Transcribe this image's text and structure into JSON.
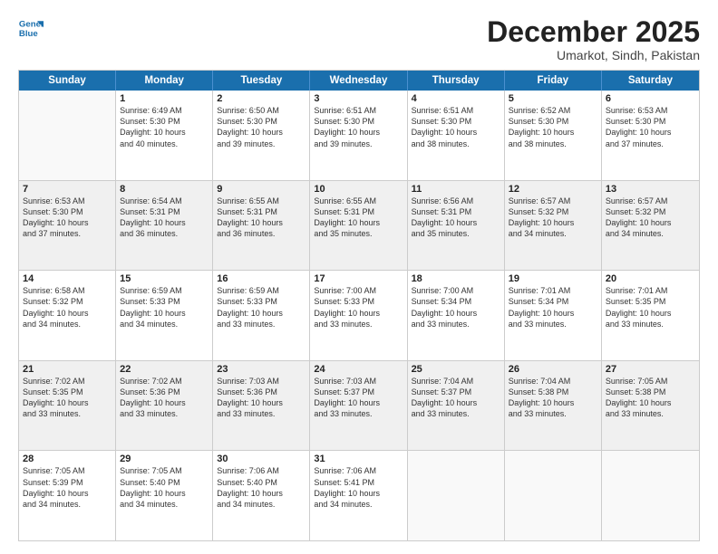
{
  "logo": {
    "line1": "General",
    "line2": "Blue"
  },
  "title": "December 2025",
  "subtitle": "Umarkot, Sindh, Pakistan",
  "header_days": [
    "Sunday",
    "Monday",
    "Tuesday",
    "Wednesday",
    "Thursday",
    "Friday",
    "Saturday"
  ],
  "rows": [
    [
      {
        "day": "",
        "detail": ""
      },
      {
        "day": "1",
        "detail": "Sunrise: 6:49 AM\nSunset: 5:30 PM\nDaylight: 10 hours\nand 40 minutes."
      },
      {
        "day": "2",
        "detail": "Sunrise: 6:50 AM\nSunset: 5:30 PM\nDaylight: 10 hours\nand 39 minutes."
      },
      {
        "day": "3",
        "detail": "Sunrise: 6:51 AM\nSunset: 5:30 PM\nDaylight: 10 hours\nand 39 minutes."
      },
      {
        "day": "4",
        "detail": "Sunrise: 6:51 AM\nSunset: 5:30 PM\nDaylight: 10 hours\nand 38 minutes."
      },
      {
        "day": "5",
        "detail": "Sunrise: 6:52 AM\nSunset: 5:30 PM\nDaylight: 10 hours\nand 38 minutes."
      },
      {
        "day": "6",
        "detail": "Sunrise: 6:53 AM\nSunset: 5:30 PM\nDaylight: 10 hours\nand 37 minutes."
      }
    ],
    [
      {
        "day": "7",
        "detail": "Sunrise: 6:53 AM\nSunset: 5:30 PM\nDaylight: 10 hours\nand 37 minutes."
      },
      {
        "day": "8",
        "detail": "Sunrise: 6:54 AM\nSunset: 5:31 PM\nDaylight: 10 hours\nand 36 minutes."
      },
      {
        "day": "9",
        "detail": "Sunrise: 6:55 AM\nSunset: 5:31 PM\nDaylight: 10 hours\nand 36 minutes."
      },
      {
        "day": "10",
        "detail": "Sunrise: 6:55 AM\nSunset: 5:31 PM\nDaylight: 10 hours\nand 35 minutes."
      },
      {
        "day": "11",
        "detail": "Sunrise: 6:56 AM\nSunset: 5:31 PM\nDaylight: 10 hours\nand 35 minutes."
      },
      {
        "day": "12",
        "detail": "Sunrise: 6:57 AM\nSunset: 5:32 PM\nDaylight: 10 hours\nand 34 minutes."
      },
      {
        "day": "13",
        "detail": "Sunrise: 6:57 AM\nSunset: 5:32 PM\nDaylight: 10 hours\nand 34 minutes."
      }
    ],
    [
      {
        "day": "14",
        "detail": "Sunrise: 6:58 AM\nSunset: 5:32 PM\nDaylight: 10 hours\nand 34 minutes."
      },
      {
        "day": "15",
        "detail": "Sunrise: 6:59 AM\nSunset: 5:33 PM\nDaylight: 10 hours\nand 34 minutes."
      },
      {
        "day": "16",
        "detail": "Sunrise: 6:59 AM\nSunset: 5:33 PM\nDaylight: 10 hours\nand 33 minutes."
      },
      {
        "day": "17",
        "detail": "Sunrise: 7:00 AM\nSunset: 5:33 PM\nDaylight: 10 hours\nand 33 minutes."
      },
      {
        "day": "18",
        "detail": "Sunrise: 7:00 AM\nSunset: 5:34 PM\nDaylight: 10 hours\nand 33 minutes."
      },
      {
        "day": "19",
        "detail": "Sunrise: 7:01 AM\nSunset: 5:34 PM\nDaylight: 10 hours\nand 33 minutes."
      },
      {
        "day": "20",
        "detail": "Sunrise: 7:01 AM\nSunset: 5:35 PM\nDaylight: 10 hours\nand 33 minutes."
      }
    ],
    [
      {
        "day": "21",
        "detail": "Sunrise: 7:02 AM\nSunset: 5:35 PM\nDaylight: 10 hours\nand 33 minutes."
      },
      {
        "day": "22",
        "detail": "Sunrise: 7:02 AM\nSunset: 5:36 PM\nDaylight: 10 hours\nand 33 minutes."
      },
      {
        "day": "23",
        "detail": "Sunrise: 7:03 AM\nSunset: 5:36 PM\nDaylight: 10 hours\nand 33 minutes."
      },
      {
        "day": "24",
        "detail": "Sunrise: 7:03 AM\nSunset: 5:37 PM\nDaylight: 10 hours\nand 33 minutes."
      },
      {
        "day": "25",
        "detail": "Sunrise: 7:04 AM\nSunset: 5:37 PM\nDaylight: 10 hours\nand 33 minutes."
      },
      {
        "day": "26",
        "detail": "Sunrise: 7:04 AM\nSunset: 5:38 PM\nDaylight: 10 hours\nand 33 minutes."
      },
      {
        "day": "27",
        "detail": "Sunrise: 7:05 AM\nSunset: 5:38 PM\nDaylight: 10 hours\nand 33 minutes."
      }
    ],
    [
      {
        "day": "28",
        "detail": "Sunrise: 7:05 AM\nSunset: 5:39 PM\nDaylight: 10 hours\nand 34 minutes."
      },
      {
        "day": "29",
        "detail": "Sunrise: 7:05 AM\nSunset: 5:40 PM\nDaylight: 10 hours\nand 34 minutes."
      },
      {
        "day": "30",
        "detail": "Sunrise: 7:06 AM\nSunset: 5:40 PM\nDaylight: 10 hours\nand 34 minutes."
      },
      {
        "day": "31",
        "detail": "Sunrise: 7:06 AM\nSunset: 5:41 PM\nDaylight: 10 hours\nand 34 minutes."
      },
      {
        "day": "",
        "detail": ""
      },
      {
        "day": "",
        "detail": ""
      },
      {
        "day": "",
        "detail": ""
      }
    ]
  ]
}
